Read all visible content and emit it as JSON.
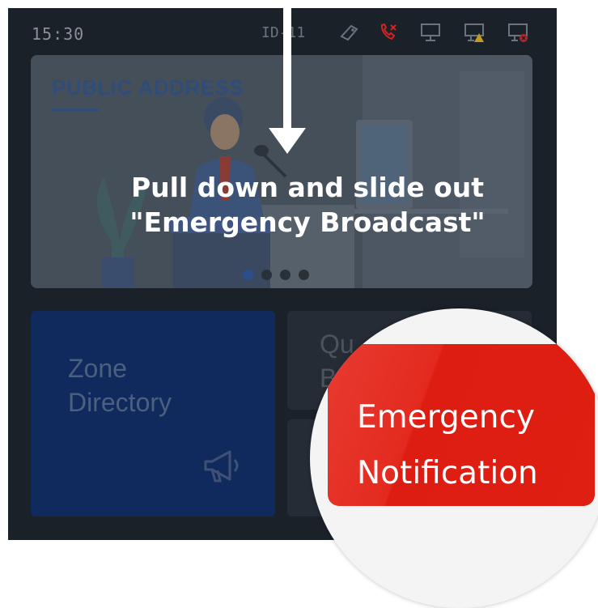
{
  "status_bar": {
    "time": "15:30",
    "device_id": "ID-11",
    "icons": [
      "tag-icon",
      "missed-call-icon",
      "monitor-icon",
      "monitor-warning-icon",
      "monitor-error-icon"
    ],
    "missed_call_color": "#d3231f"
  },
  "banner": {
    "title": "PUBLIC ADDRESS",
    "carousel_pages": 4,
    "active_page": 1
  },
  "tiles": {
    "zone_directory": {
      "label_line1": "Zone",
      "label_line2": "Directory",
      "icon": "megaphone-icon"
    },
    "quick": {
      "label_line1": "Qu",
      "label_line2": "B"
    }
  },
  "guide": {
    "line1": "Pull down and slide out",
    "line2": "\"Emergency Broadcast\""
  },
  "emergency_button": {
    "line1": "Emergency",
    "line2": "Notification",
    "color": "#e0201a"
  }
}
